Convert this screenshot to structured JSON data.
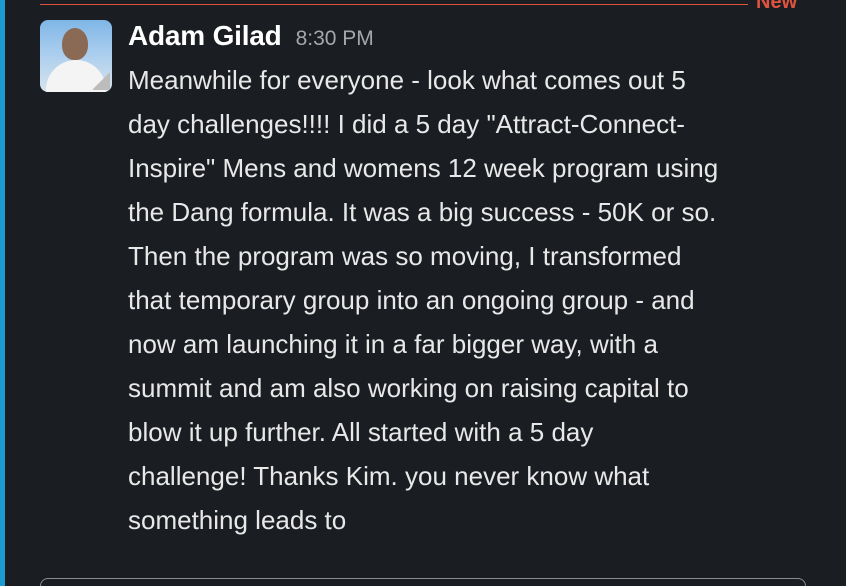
{
  "divider": {
    "label": "New",
    "color": "#e0533f"
  },
  "message": {
    "author": "Adam Gilad",
    "timestamp": "8:30 PM",
    "body": "Meanwhile for everyone - look what comes out 5\nday challenges!!!!  I did a 5 day \"Attract-Connect-\nInspire\" Mens and womens 12 week program using\nthe Dang formula.  It was a big success - 50K or so.\nThen the program was so moving, I transformed\nthat temporary group into an ongoing group - and\nnow am launching it in a far bigger way, with a\nsummit and am also working on raising capital to\nblow it up further.  All started with a 5 day\nchallenge!  Thanks Kim.  you never know what\nsomething leads to"
  },
  "colors": {
    "background": "#1a1d21",
    "accent": "#1d9bd1",
    "text": "#e8e8e8",
    "muted": "#a6a7ab"
  }
}
